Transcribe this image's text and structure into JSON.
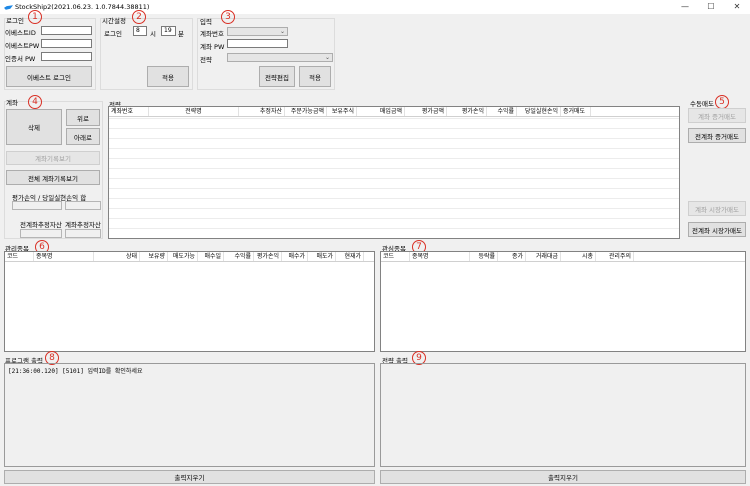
{
  "window": {
    "title": "StockShip2(2021.06.23.  1.0.7844.38811)",
    "controls": {
      "minimize": "—",
      "maximize": "☐",
      "close": "✕"
    }
  },
  "badges": [
    "1",
    "2",
    "3",
    "4",
    "5",
    "6",
    "7",
    "8",
    "9"
  ],
  "login": {
    "header": "로그인",
    "id_label": "이베스트ID",
    "pw_label": "이베스트PW",
    "cert_label": "인증서 PW",
    "id_value": "",
    "pw_value": "",
    "cert_value": "",
    "login_button": "이베스트 로그인"
  },
  "time": {
    "header": "시간설정",
    "login_label": "로그인",
    "hour_value": "8",
    "hour_label": "시",
    "minute_value": "19",
    "minute_label": "분",
    "apply_button": "적용"
  },
  "strategy_input": {
    "header": "입력",
    "account_label": "계좌번호",
    "account_pw_label": "계좌 PW",
    "strategy_label": "전략",
    "account_value": "",
    "account_pw_value": "",
    "strategy_value": "",
    "edit_button": "전략편집",
    "apply_button": "적용"
  },
  "account": {
    "header": "계좌",
    "delete_button": "삭제",
    "up_button": "위로",
    "down_button": "아래로",
    "view_account_button": "계좌기록보기",
    "view_all_button": "전체 계좌기록보기",
    "eval_label": "평가손익 / 당일실현손익 합",
    "total_label": "전계좌추정자산",
    "account_total_label": "계좌추정자산",
    "eval_value": "",
    "realized_value": "",
    "total_value": "",
    "account_total_value": ""
  },
  "strategy": {
    "header": "전략",
    "columns": [
      "계좌번호",
      "전략명",
      "추정자산",
      "주문가능금액",
      "보유주식",
      "매입금액",
      "평가금액",
      "평가손익",
      "수익률",
      "당일실현손익",
      "증거매도"
    ]
  },
  "manual_sell": {
    "header": "수동매도",
    "account_margin_button": "계좌 증거매도",
    "all_margin_button": "전계좌 증거매도",
    "account_market_button": "계좌 시장가매도",
    "all_market_button": "전계좌 시장가매도"
  },
  "managed": {
    "header": "관리종목",
    "columns": [
      "코드",
      "종목명",
      "상태",
      "보유량",
      "매도가능",
      "매수일",
      "수익률",
      "평가손익",
      "매수가",
      "매도가",
      "현재가"
    ]
  },
  "watch": {
    "header": "관심종목",
    "columns": [
      "코드",
      "종목명",
      "등락률",
      "종가",
      "거래대금",
      "시총",
      "관리주의"
    ]
  },
  "program_log": {
    "header": "프로그램 출력",
    "lines": [
      "[21:36:00.120] [5101] 입력ID를 확인하세요"
    ],
    "clear_button": "출력지우기"
  },
  "strategy_log": {
    "header": "전략 출력",
    "lines": [],
    "clear_button": "출력지우기"
  }
}
